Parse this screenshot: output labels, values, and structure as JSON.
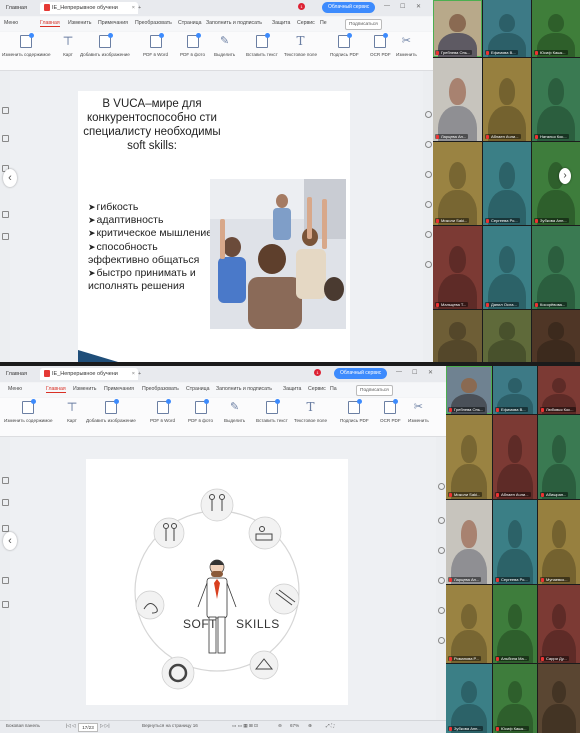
{
  "shot1": {
    "tabs": {
      "home": "Главная",
      "doc": "IE_Непрерывное обучени",
      "close": "×",
      "plus": "+",
      "badge": "1"
    },
    "cloud_button": "Облачный сервис",
    "window_controls": [
      "—",
      "☐",
      "✕"
    ],
    "menu": {
      "hamburger": "Меню",
      "items": [
        "Главная",
        "Изменить",
        "Примечания",
        "Преобразовать",
        "Страница",
        "Заполнить и подписать",
        "Защита",
        "Сервис",
        "Пе"
      ],
      "subscribe": "Подписаться"
    },
    "ribbon": [
      "Изменить содержимое",
      "Карт",
      "Добавить изображение",
      "PDF в Word",
      "PDF в фото",
      "Выделить",
      "Вставить текст",
      "Текстовое поле",
      "Подпись PDF",
      "OCR PDF",
      "Изменить"
    ],
    "slide": {
      "heading": "В VUCA–мире для конкурентоспособно сти специалисту необходимы soft skills:",
      "bullets": [
        "гибкость",
        "адаптивность",
        "критическое мышление",
        "способность эффективно общаться",
        "быстро принимать и исполнять решения"
      ]
    },
    "participants": [
      "Гребнева Оль...",
      "Ефимова В...",
      "Юсиф Кашк...",
      "Ларцева Ан...",
      "Аблаен Ачли...",
      "Наталья Кос...",
      "Миколи Saki...",
      "Сергеева Ро...",
      "Зубкова Анн...",
      "Мальцева Т...",
      "Данил Осла...",
      "Косорёвова..."
    ]
  },
  "shot2": {
    "tabs": {
      "home": "Главная",
      "doc": "IE_Непрерывное обучени",
      "close": "×",
      "plus": "+",
      "badge": "1"
    },
    "cloud_button": "Облачный сервис",
    "window_controls": [
      "—",
      "☐",
      "✕"
    ],
    "menu": {
      "hamburger": "Меню",
      "items": [
        "Главная",
        "Изменить",
        "Примечания",
        "Преобразовать",
        "Страница",
        "Заполнить и подписать",
        "Защита",
        "Сервис",
        "Па"
      ],
      "subscribe": "Подписаться"
    },
    "ribbon": [
      "Изменить содержимое",
      "Карт",
      "Добавить изображение",
      "PDF в Word",
      "PDF в фото",
      "Выделить",
      "Вставить текст",
      "Текстовое поле",
      "Подпись PDF",
      "OCR PDF",
      "Изменить"
    ],
    "slide": {
      "soft": "SOFT",
      "skills": "SKILLS"
    },
    "statusbar": {
      "left": "Боковая панель",
      "page": "17/23",
      "return": "Вернуться на страницу 16",
      "zoom": "67%"
    },
    "participants": [
      "Гребнева Оль...",
      "Ефимова В...",
      "Любовья Кос...",
      "Миколи Saki...",
      "Аблаен Ачли...",
      "Абишрап...",
      "Ларцева Ан...",
      "Сергеева Ро...",
      "Мунаевко...",
      "Романова Р...",
      "Альбина Ма...",
      "Сарри Ду...",
      "Зубкова Анн...",
      "Юсиф Кашк..."
    ]
  },
  "colors": {
    "accent": "#d93025",
    "cloud": "#3d8bfd",
    "slide_band": "#1f4e79",
    "active_speaker": "#4caf50"
  }
}
